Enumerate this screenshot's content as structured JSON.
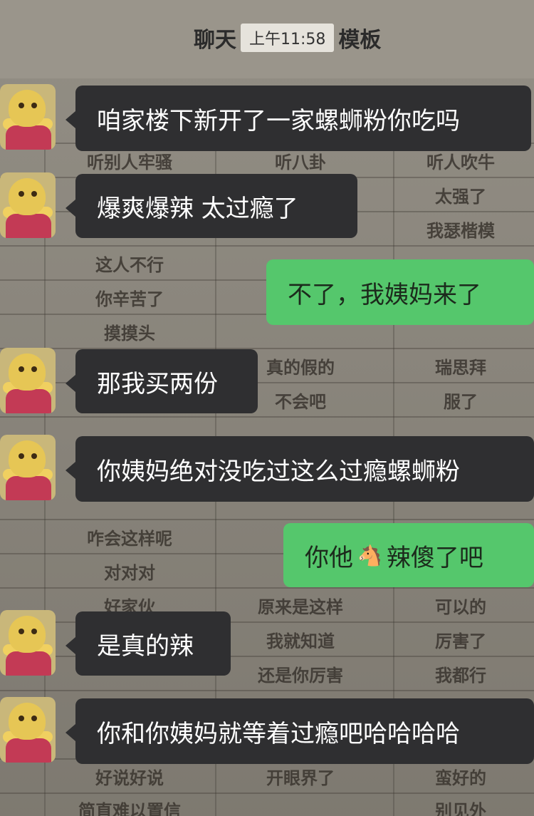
{
  "header": {
    "title_left": "聊天",
    "time": "上午11:58",
    "title_right": "模板"
  },
  "messages": [
    {
      "side": "left",
      "text": "咱家楼下新开了一家螺蛳粉你吃吗"
    },
    {
      "side": "left",
      "text": "爆爽爆辣  太过瘾了"
    },
    {
      "side": "right",
      "text": "不了，我姨妈来了"
    },
    {
      "side": "left",
      "text": "那我买两份"
    },
    {
      "side": "left",
      "text": "你姨妈绝对没吃过这么过瘾螺蛳粉"
    },
    {
      "side": "right",
      "text_before": "你他",
      "emoji": "🐴",
      "emoji_name": "horse-icon",
      "text_after": "辣傻了吧"
    },
    {
      "side": "left",
      "text": "是真的辣"
    },
    {
      "side": "left",
      "text": "你和你姨妈就等着过瘾吧哈哈哈哈"
    }
  ],
  "background_template": {
    "cells": [
      "听别人牢骚",
      "听八卦",
      "听人吹牛",
      "太强了",
      "我瑟楷模",
      "这人不行",
      "你辛苦了",
      "摸摸头",
      "真的假的",
      "瑞思拜",
      "不会吧",
      "服了",
      "咋会这样呢",
      "对对对",
      "好家伙",
      "原来是这样",
      "可以的",
      "我就知道",
      "厉害了",
      "还是你厉害",
      "我都行",
      "好说好说",
      "开眼界了",
      "蛮好的",
      "简直难以置信",
      "别见外"
    ]
  },
  "colors": {
    "left_bubble": "#2f2f31",
    "right_bubble": "#55c76c",
    "background": "#8c877d"
  }
}
